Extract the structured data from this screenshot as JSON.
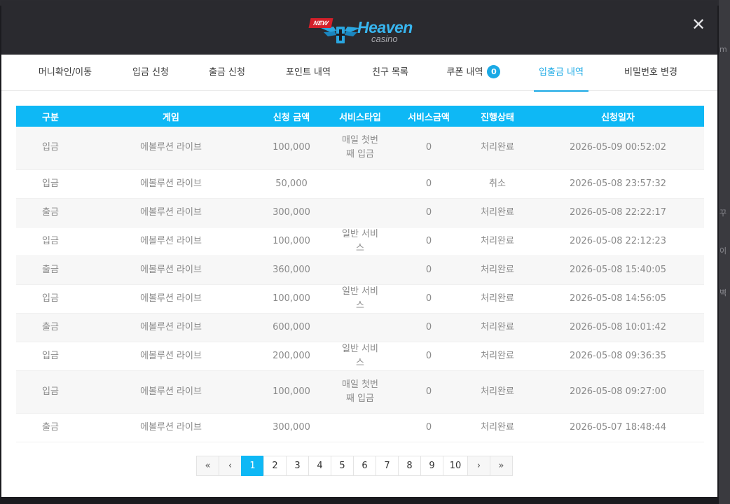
{
  "brand": {
    "badge": "NEW",
    "name": "Heaven",
    "sub": "casino"
  },
  "close_label": "✕",
  "tabs": [
    {
      "label": "머니확인/이동"
    },
    {
      "label": "입금 신청"
    },
    {
      "label": "출금 신청"
    },
    {
      "label": "포인트 내역"
    },
    {
      "label": "친구 목록"
    },
    {
      "label": "쿠폰 내역",
      "badge": "0"
    },
    {
      "label": "입출금 내역",
      "active": true
    },
    {
      "label": "비밀번호 변경"
    }
  ],
  "table": {
    "headers": [
      "구분",
      "게임",
      "신청 금액",
      "서비스타입",
      "서비스금액",
      "진행상태",
      "신청일자"
    ],
    "rows": [
      [
        "입금",
        "에볼루션 라이브",
        "100,000",
        "매일 첫번째 입금",
        "0",
        "처리완료",
        "2026-05-09 00:52:02"
      ],
      [
        "입금",
        "에볼루션 라이브",
        "50,000",
        "",
        "0",
        "취소",
        "2026-05-08 23:57:32"
      ],
      [
        "출금",
        "에볼루션 라이브",
        "300,000",
        "",
        "0",
        "처리완료",
        "2026-05-08 22:22:17"
      ],
      [
        "입금",
        "에볼루션 라이브",
        "100,000",
        "일반 서비스",
        "0",
        "처리완료",
        "2026-05-08 22:12:23"
      ],
      [
        "출금",
        "에볼루션 라이브",
        "360,000",
        "",
        "0",
        "처리완료",
        "2026-05-08 15:40:05"
      ],
      [
        "입금",
        "에볼루션 라이브",
        "100,000",
        "일반 서비스",
        "0",
        "처리완료",
        "2026-05-08 14:56:05"
      ],
      [
        "출금",
        "에볼루션 라이브",
        "600,000",
        "",
        "0",
        "처리완료",
        "2026-05-08 10:01:42"
      ],
      [
        "입금",
        "에볼루션 라이브",
        "200,000",
        "일반 서비스",
        "0",
        "처리완료",
        "2026-05-08 09:36:35"
      ],
      [
        "입금",
        "에볼루션 라이브",
        "100,000",
        "매일 첫번째 입금",
        "0",
        "처리완료",
        "2026-05-08 09:27:00"
      ],
      [
        "출금",
        "에볼루션 라이브",
        "300,000",
        "",
        "0",
        "처리완료",
        "2026-05-07 18:48:44"
      ]
    ]
  },
  "pagination": {
    "first": "«",
    "prev": "‹",
    "next": "›",
    "last": "»",
    "pages": [
      "1",
      "2",
      "3",
      "4",
      "5",
      "6",
      "7",
      "8",
      "9",
      "10"
    ],
    "current": "1"
  },
  "colors": {
    "accent": "#0eb8f5",
    "header_bg": "#2a2a2f"
  }
}
